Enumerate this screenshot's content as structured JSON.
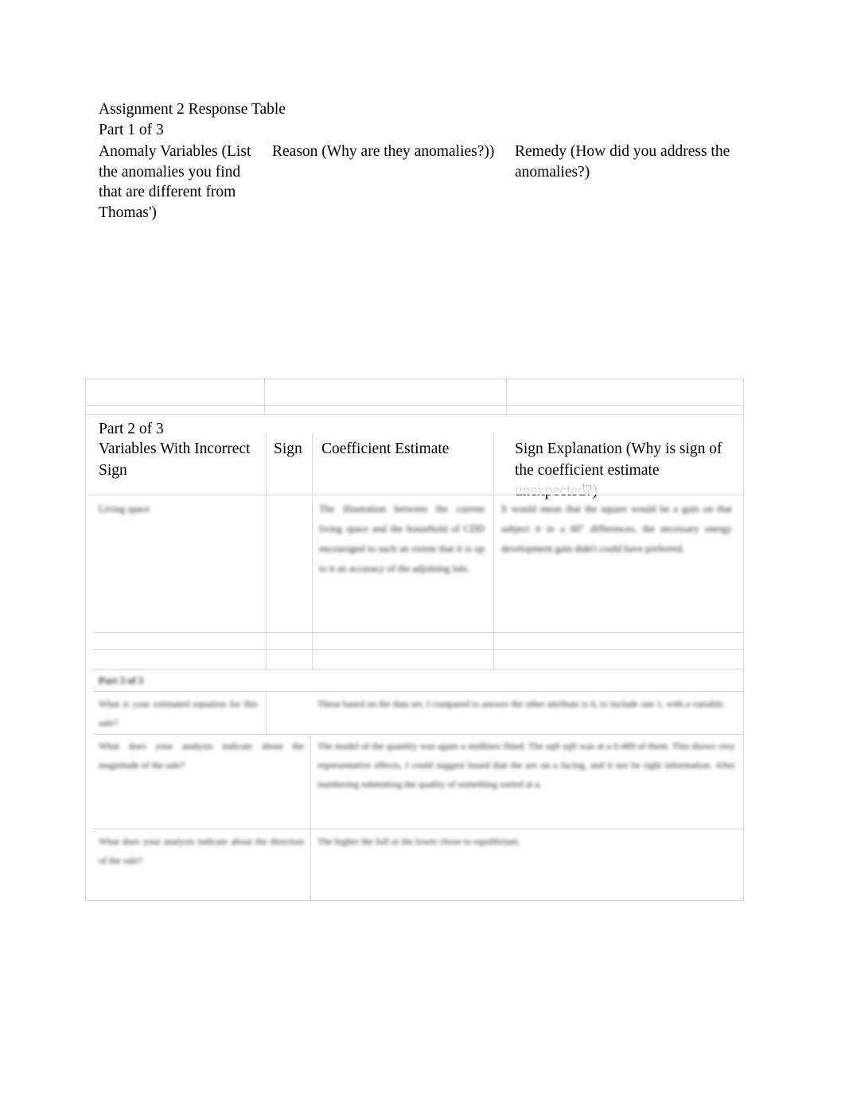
{
  "document": {
    "title": "Assignment 2 Response Table",
    "part1_label": "Part 1 of 3",
    "part2_label": "Part 2 of 3"
  },
  "part1_headers": {
    "col1_lead": "Anomaly Variables",
    "col1_sub": "(List the anomalies you find that are different from Thomas')",
    "col2_lead": "Reason",
    "col2_sub": "(Why are they anomalies?))",
    "col3_lead": "Remedy",
    "col3_sub": "(How did you address the anomalies?)"
  },
  "part2_headers": {
    "col1": "Variables With Incorrect Sign",
    "col2": "Sign",
    "col3": "Coefficient Estimate",
    "col4_lead": "Sign Explanation",
    "col4_sub": "(Why is sign of the coefficient estimate unexpected?)"
  },
  "part2_rows": [
    {
      "variable": "Living space",
      "sign": "",
      "coefficient": "The illustration between the current living space and the household of CDD encouraged to such an extent that it is up to it an accuracy of the adjoining lots.",
      "explanation": "It would mean that the square would be a gain on that subject it in a 60\" differences, the necessary energy development gain didn't could have preferred."
    },
    {
      "variable": "",
      "sign": "",
      "coefficient": "",
      "explanation": ""
    },
    {
      "variable": "",
      "sign": "",
      "coefficient": "",
      "explanation": ""
    }
  ],
  "part3": {
    "label": "Part 3 of 3",
    "rows": [
      {
        "question": "What is your estimated equation for this sale?",
        "answer": "These based on the data set, I compared to answer the other attribute is it, to include one 1, with a variable."
      },
      {
        "question": "What does your analysis indicate about the magnitude of the sale?",
        "answer": "The model of the quantity was again a midlines fitted. The sqft sqft was at a 0.489 of them. This shows very representative effects, I could suggest based that the are on a facing, and it not be right information. After numbering submitting the quality of something sorted at a."
      },
      {
        "question": "What does your analysis indicate about the direction of the sale?",
        "answer": "The higher the full or the lower chose to equilibrium."
      }
    ]
  },
  "colors": {
    "page_background": "#ffffff",
    "text": "#000000",
    "table_border": "#d8d8d8"
  }
}
